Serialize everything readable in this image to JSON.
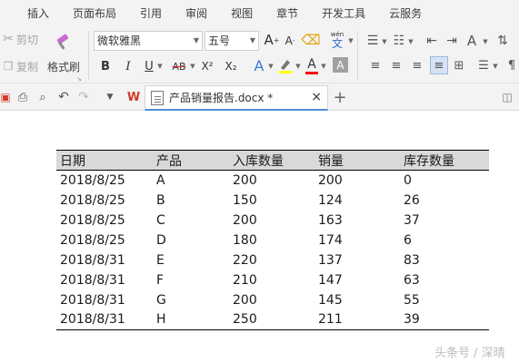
{
  "menu": [
    "插入",
    "页面布局",
    "引用",
    "审阅",
    "视图",
    "章节",
    "开发工具",
    "云服务"
  ],
  "ribbon": {
    "cut": "剪切",
    "copy": "复制",
    "format_painter": "格式刷",
    "font_name": "微软雅黑",
    "font_size": "五号",
    "bold": "B",
    "italic": "I",
    "underline": "U",
    "strikethrough": "AB",
    "superscript": "X²",
    "subscript": "X₂",
    "pinyin_top": "wén",
    "pinyin_bottom": "文",
    "font_color": "#ff0000",
    "highlight_color": "#ffff00"
  },
  "tab": {
    "title": "产品销量报告.docx *",
    "close": "×",
    "new_tab": "+"
  },
  "table": {
    "headers": [
      "日期",
      "产品",
      "入库数量",
      "销量",
      "库存数量"
    ],
    "rows": [
      [
        "2018/8/25",
        "A",
        "200",
        "200",
        "0"
      ],
      [
        "2018/8/25",
        "B",
        "150",
        "124",
        "26"
      ],
      [
        "2018/8/25",
        "C",
        "200",
        "163",
        "37"
      ],
      [
        "2018/8/25",
        "D",
        "180",
        "174",
        "6"
      ],
      [
        "2018/8/31",
        "E",
        "220",
        "137",
        "83"
      ],
      [
        "2018/8/31",
        "F",
        "210",
        "147",
        "63"
      ],
      [
        "2018/8/31",
        "G",
        "200",
        "145",
        "55"
      ],
      [
        "2018/8/31",
        "H",
        "250",
        "211",
        "39"
      ]
    ]
  },
  "watermark": "头条号 / 深晴"
}
